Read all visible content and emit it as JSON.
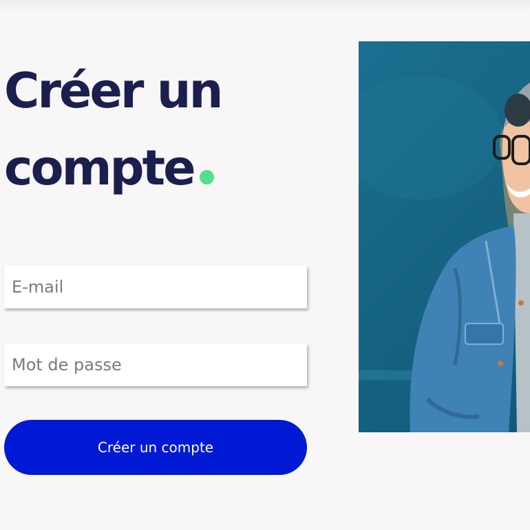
{
  "heading": {
    "line1": "Créer un",
    "line2": "compte"
  },
  "form": {
    "email_placeholder": "E-mail",
    "password_placeholder": "Mot de passe",
    "submit_label": "Créer un compte"
  },
  "colors": {
    "page_background": "#f8f6f6",
    "heading": "#1a1f4d",
    "accent_dot": "#4ee08a",
    "button": "#0019d4",
    "photo_wall": "#176584"
  },
  "photo": {
    "subject": "smiling woman with glasses in a denim jacket against a teal wall"
  }
}
